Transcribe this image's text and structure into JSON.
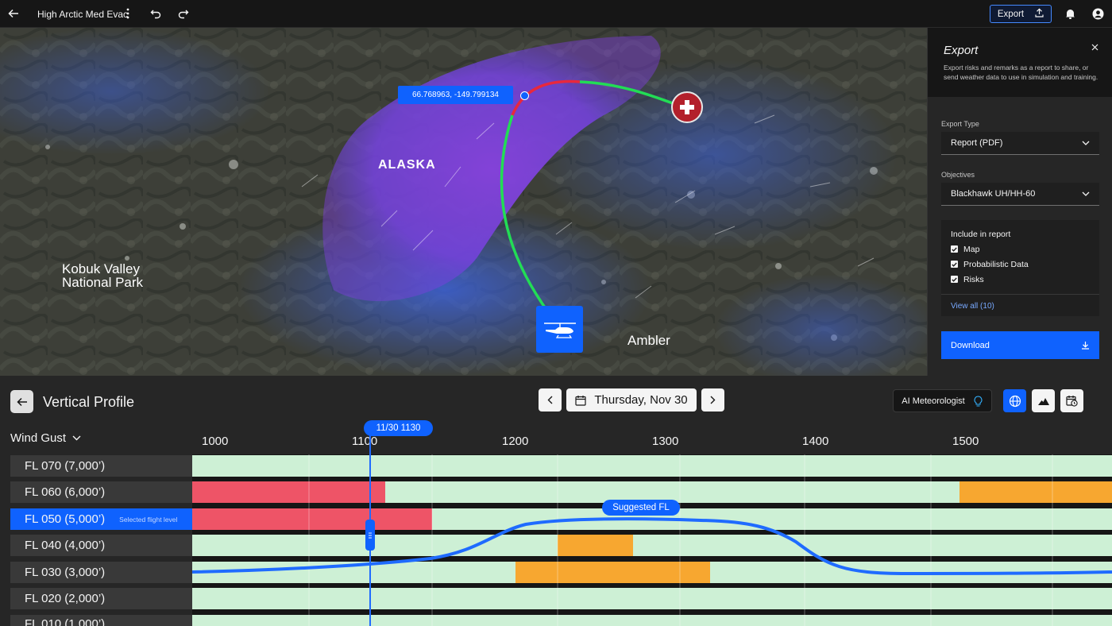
{
  "topbar": {
    "title": "High Arctic Med Evac",
    "export_label": "Export"
  },
  "map": {
    "region_label": "ALASKA",
    "park_label_line1": "Kobuk Valley",
    "park_label_line2": "National Park",
    "town_label": "Ambler",
    "coordinate_readout": "66.768963, -149.799134"
  },
  "export_panel": {
    "title": "Export",
    "description": "Export risks and remarks as a report to share, or send weather data to use in simulation and training.",
    "export_type_label": "Export Type",
    "export_type_value": "Report (PDF)",
    "objectives_label": "Objectives",
    "objectives_value": "Blackhawk UH/HH-60",
    "include_label": "Include in report",
    "include_items": [
      "Map",
      "Probabilistic Data",
      "Risks"
    ],
    "view_all": "View all (10)",
    "download_label": "Download"
  },
  "profile": {
    "title": "Vertical Profile",
    "metric": "Wind Gust",
    "date": "Thursday, Nov 30",
    "ai_label": "AI Meteorologist",
    "cursor_time": "11/30 1130",
    "suggested_label": "Suggested FL",
    "selected_hint": "Selected flight level",
    "time_ticks": [
      "1000",
      "1100",
      "1200",
      "1300",
      "1400",
      "1500"
    ],
    "flight_levels": [
      "FL 070 (7,000’)",
      "FL 060 (6,000’)",
      "FL 050 (5,000’)",
      "FL 040 (4,000’)",
      "FL 030 (3,000’)",
      "FL 020 (2,000’)",
      "FL 010 (1,000’)"
    ],
    "colors": {
      "low": "#cdf0d5",
      "high": "#ee5467",
      "medium": "#f7a730",
      "accent": "#0f62fe"
    }
  }
}
